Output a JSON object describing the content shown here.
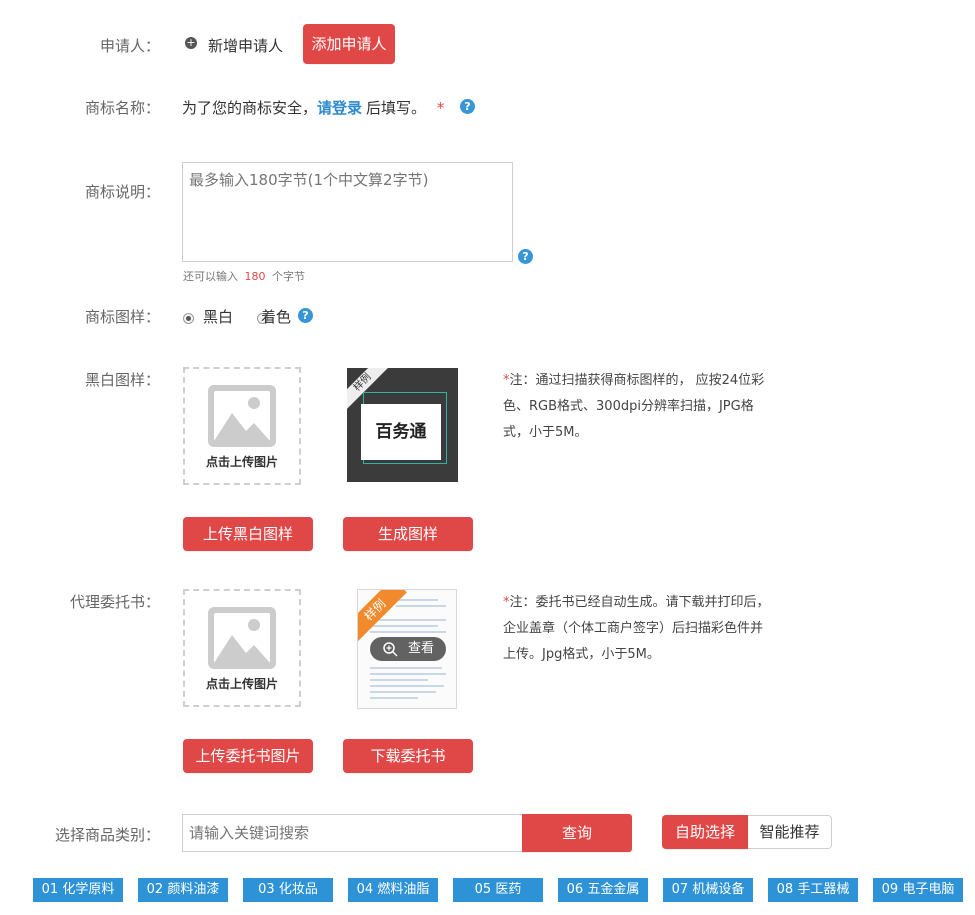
{
  "applicant": {
    "label": "申请人：",
    "new_applicant": "新增申请人",
    "add_button": "添加申请人"
  },
  "trademark_name": {
    "label": "商标名称：",
    "text_before": "为了您的商标安全，",
    "login_link": "请登录",
    "text_after": "后填写。",
    "required": "*",
    "help": "?"
  },
  "trademark_desc": {
    "label": "商标说明：",
    "placeholder": "最多输入180字节(1个中文算2字节)",
    "remaining_prefix": "还可以输入",
    "remaining_count": "180",
    "remaining_suffix": "个字节",
    "help": "?"
  },
  "trademark_style": {
    "label": "商标图样：",
    "options": [
      "黑白",
      "着色"
    ],
    "selected": "黑白",
    "help": "?"
  },
  "bw_sample": {
    "label": "黑白图样：",
    "upload_caption": "点击上传图片",
    "example_ribbon": "样例",
    "example_text": "百务通",
    "note_star": "*",
    "note": "注：通过扫描获得商标图样的， 应按24位彩色、RGB格式、300dpi分辨率扫描，JPG格式，小于5M。",
    "upload_button": "上传黑白图样",
    "generate_button": "生成图样"
  },
  "power_of_attorney": {
    "label": "代理委托书：",
    "upload_caption": "点击上传图片",
    "example_ribbon": "样例",
    "view_label": "查看",
    "note_star": "*",
    "note": "注：委托书已经自动生成。请下载并打印后，企业盖章（个体工商户签字）后扫描彩色件并上传。Jpg格式，小于5M。",
    "upload_button": "上传委托书图片",
    "download_button": "下载委托书"
  },
  "goods_category": {
    "label": "选择商品类别：",
    "search_placeholder": "请输入关键词搜索",
    "query_button": "查询",
    "self_select": "自助选择",
    "smart_recommend": "智能推荐",
    "categories": [
      "01 化学原料",
      "02 颜料油漆",
      "03 化妆品",
      "04 燃料油脂",
      "05 医药",
      "06 五金金属",
      "07 机械设备",
      "08 手工器械",
      "09 电子电脑"
    ]
  },
  "colors": {
    "accent_red": "#e04848",
    "link_blue": "#2e8bd0",
    "category_blue": "#2e93d6"
  }
}
